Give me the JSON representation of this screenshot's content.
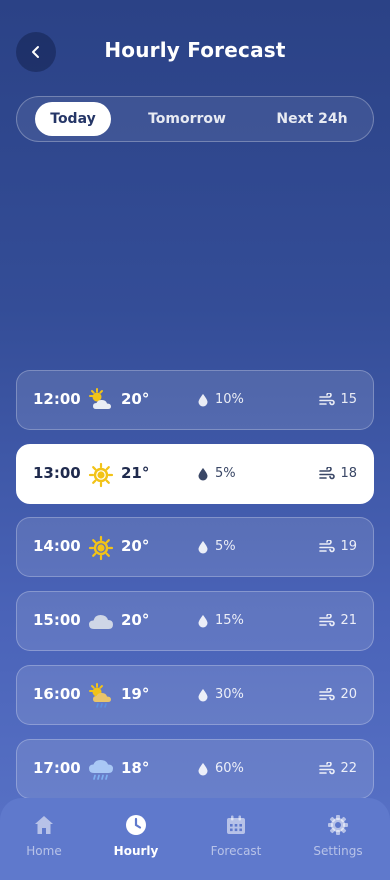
{
  "header": {
    "title": "Hourly Forecast",
    "back_icon": "chevron-left-icon"
  },
  "tabs": [
    {
      "label": "Today",
      "active": true
    },
    {
      "label": "Tomorrow",
      "active": false
    },
    {
      "label": "Next 24h",
      "active": false
    }
  ],
  "forecast": [
    {
      "time": "12:00",
      "icon": "partly-sunny-icon",
      "temp": "20°",
      "rain": "10%",
      "wind": "15",
      "selected": false
    },
    {
      "time": "13:00",
      "icon": "sun-icon",
      "temp": "21°",
      "rain": "5%",
      "wind": "18",
      "selected": true
    },
    {
      "time": "14:00",
      "icon": "sun-icon",
      "temp": "20°",
      "rain": "5%",
      "wind": "19",
      "selected": false
    },
    {
      "time": "15:00",
      "icon": "cloud-icon",
      "temp": "20°",
      "rain": "15%",
      "wind": "21",
      "selected": false
    },
    {
      "time": "16:00",
      "icon": "sun-rain-cloud-icon",
      "temp": "19°",
      "rain": "30%",
      "wind": "20",
      "selected": false
    },
    {
      "time": "17:00",
      "icon": "rain-cloud-icon",
      "temp": "18°",
      "rain": "60%",
      "wind": "22",
      "selected": false
    }
  ],
  "nav": [
    {
      "label": "Home",
      "icon": "home-icon",
      "active": false
    },
    {
      "label": "Hourly",
      "icon": "clock-icon",
      "active": true
    },
    {
      "label": "Forecast",
      "icon": "calendar-icon",
      "active": false
    },
    {
      "label": "Settings",
      "icon": "gear-icon",
      "active": false
    }
  ],
  "colors": {
    "sun": "#f2c318",
    "cloud": "#cfd6e6",
    "accent": "#253667"
  }
}
